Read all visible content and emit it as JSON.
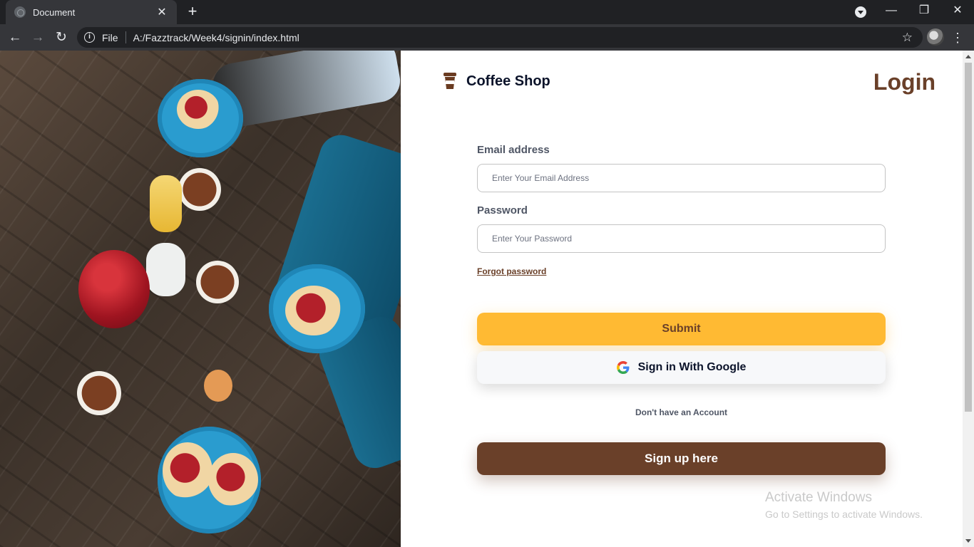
{
  "browser": {
    "tab_title": "Document",
    "url_scheme": "File",
    "url": "A:/Fazztrack/Week4/signin/index.html"
  },
  "page": {
    "brand": "Coffee Shop",
    "heading": "Login",
    "email_label": "Email address",
    "email_placeholder": "Enter Your Email Address",
    "password_label": "Password",
    "password_placeholder": "Enter Your Password",
    "forgot_link": "Forgot password",
    "submit_label": "Submit",
    "google_label": "Sign in With Google",
    "account_text": "Don't have an Account",
    "signup_label": "Sign up here"
  },
  "overlay": {
    "activate_title": "Activate Windows",
    "activate_sub": "Go to Settings to activate Windows."
  },
  "colors": {
    "brand_brown": "#6a4029",
    "accent_yellow": "#ffba33",
    "text_dark": "#0b132a"
  },
  "icons": [
    "tab-favicon-icon",
    "close-icon",
    "plus-icon",
    "profile-icon",
    "minimize-icon",
    "restore-icon",
    "back-icon",
    "forward-icon",
    "reload-icon",
    "info-icon",
    "star-icon",
    "avatar-icon",
    "menu-icon",
    "coffee-cup-icon",
    "google-icon"
  ]
}
